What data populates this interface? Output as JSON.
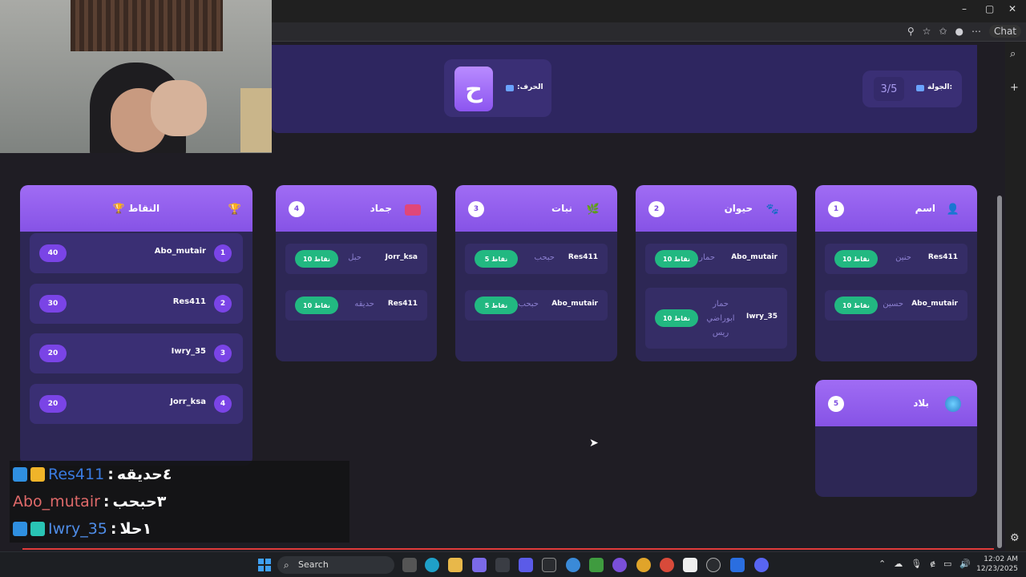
{
  "browser": {
    "controls": {
      "minimize": "–",
      "maximize": "▢",
      "close": "✕"
    },
    "chat_label": "Chat"
  },
  "game": {
    "letter_label": "الحرف:",
    "letter": "ح",
    "round_label": "الجولة:",
    "round_value": "3/5"
  },
  "categories": [
    {
      "title": "اسم",
      "number": "1",
      "icon": "person-icon",
      "entries": [
        {
          "player": "Res411",
          "word": "حنين",
          "points": "10 نقاط"
        },
        {
          "player": "Abo_mutair",
          "word": "حسين",
          "points": "10 نقاط"
        }
      ]
    },
    {
      "title": "حيوان",
      "number": "2",
      "icon": "paw-icon",
      "entries": [
        {
          "player": "Abo_mutair",
          "word": "حمار",
          "points": "10 نقاط"
        },
        {
          "player": "Iwry_35",
          "word": "حمار ابوراضي ريس",
          "points": "10 نقاط"
        }
      ]
    },
    {
      "title": "نبات",
      "number": "3",
      "icon": "leaf-icon",
      "entries": [
        {
          "player": "Res411",
          "word": "حبحب",
          "points": "5 نقاط"
        },
        {
          "player": "Abo_mutair",
          "word": "حبحب",
          "points": "5 نقاط"
        }
      ]
    },
    {
      "title": "جماد",
      "number": "4",
      "icon": "object-icon",
      "entries": [
        {
          "player": "Jorr_ksa",
          "word": "حبل",
          "points": "10 نقاط"
        },
        {
          "player": "Res411",
          "word": "حديقه",
          "points": "10 نقاط"
        }
      ]
    },
    {
      "title": "بلاد",
      "number": "5",
      "icon": "globe-icon",
      "entries": []
    }
  ],
  "scoreboard": {
    "title": "🏆 النقاط",
    "rows": [
      {
        "rank": "1",
        "name": "Abo_mutair",
        "score": "40"
      },
      {
        "rank": "2",
        "name": "Res411",
        "score": "30"
      },
      {
        "rank": "3",
        "name": "Iwry_35",
        "score": "20"
      },
      {
        "rank": "4",
        "name": "Jorr_ksa",
        "score": "20"
      }
    ]
  },
  "chat": [
    {
      "name": "Res411",
      "message": "٤حديقه",
      "name_color": "#3a7be0"
    },
    {
      "name": "Abo_mutair",
      "message": "٣حبحب",
      "name_color": "#e06a6a"
    },
    {
      "name": "Iwry_35",
      "message": "١حلا",
      "name_color": "#4f8de8"
    }
  ],
  "taskbar": {
    "search_label": "Search",
    "time": "12:02 AM",
    "date": "12/23/2025"
  }
}
